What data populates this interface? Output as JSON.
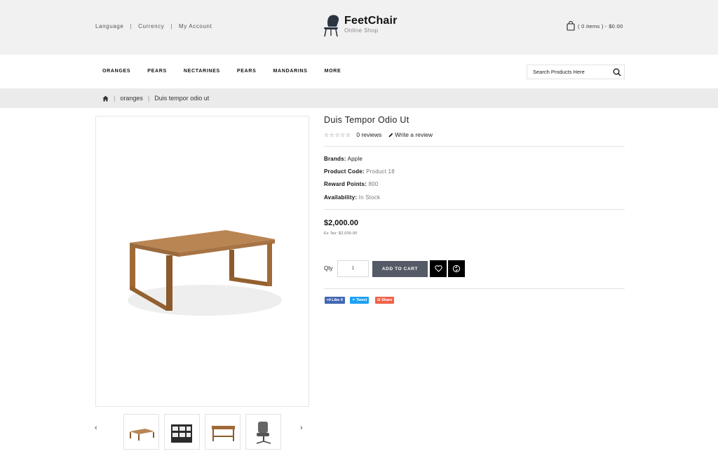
{
  "header": {
    "links": [
      "Language",
      "Currency",
      "My Account"
    ],
    "logo": {
      "title": "FeetChair",
      "subtitle": "Online Shop"
    },
    "cart_summary": "( 0 items ) - $0.00"
  },
  "nav": {
    "items": [
      "ORANGES",
      "PEARS",
      "NECTARINES",
      "PEARS",
      "MANDARINS",
      "MORE"
    ],
    "search_placeholder": "Search Products Here"
  },
  "breadcrumb": {
    "items": [
      "oranges",
      "Duis tempor odio ut"
    ]
  },
  "product": {
    "title": "Duis Tempor Odio Ut",
    "reviews": "0 reviews",
    "write_review": "Write a review",
    "specs": [
      {
        "label": "Brands:",
        "value": "Apple"
      },
      {
        "label": "Product Code:",
        "value": "Product 18"
      },
      {
        "label": "Reward Points:",
        "value": "800"
      },
      {
        "label": "Availability:",
        "value": "In Stock"
      }
    ],
    "price": "$2,000.00",
    "ex_tax": "Ex Tax: $2,000.00",
    "qty_label": "Qty",
    "qty_value": "1",
    "add_to_cart": "ADD TO CART"
  },
  "social": {
    "like": "Like 0",
    "tweet": "Tweet",
    "share": "Share"
  },
  "colors": {
    "topbar": "#f1f1f1",
    "crumbbar": "#ebebeb",
    "add_to_cart": "#545b66",
    "facebook": "#4267b2",
    "twitter": "#1da1f2",
    "share": "#f0624a"
  }
}
